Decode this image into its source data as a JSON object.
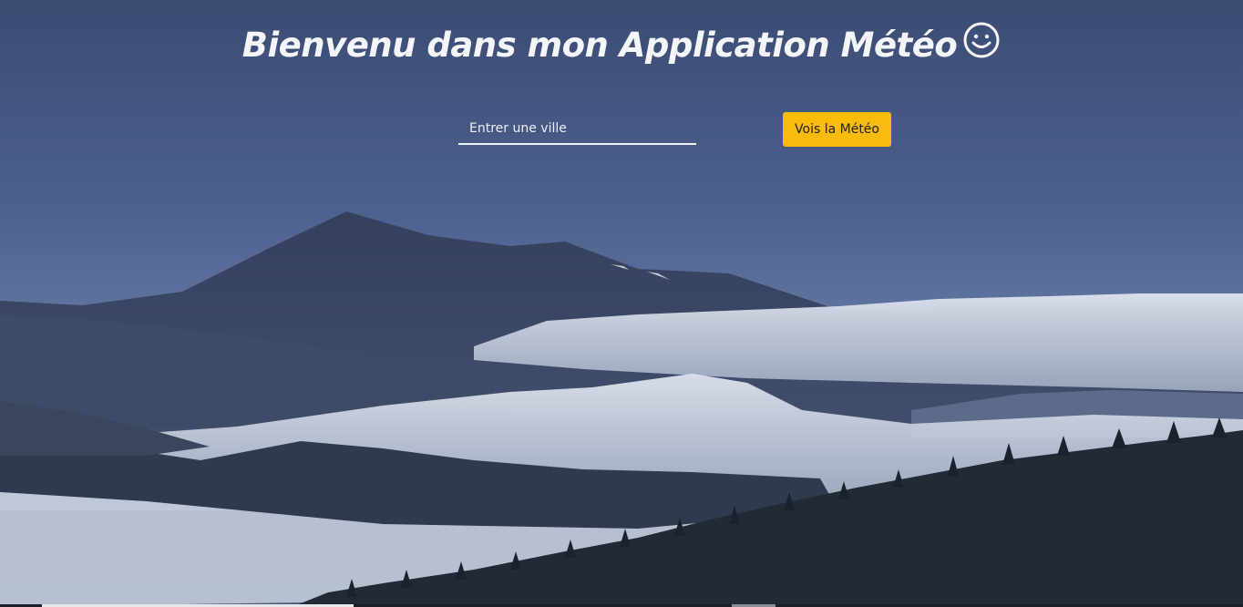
{
  "page": {
    "title": "Bienvenu dans mon Application Météo",
    "title_icon": "smiley-face-icon"
  },
  "search": {
    "placeholder": "Entrer une ville",
    "value": ""
  },
  "actions": {
    "submit_label": "Vois la Météo"
  },
  "background": {
    "description_icon": "mountain-landscape-image"
  },
  "colors": {
    "button": "#f9bc0c",
    "title": "#f4f5f8",
    "sky": "#4a5e88"
  }
}
